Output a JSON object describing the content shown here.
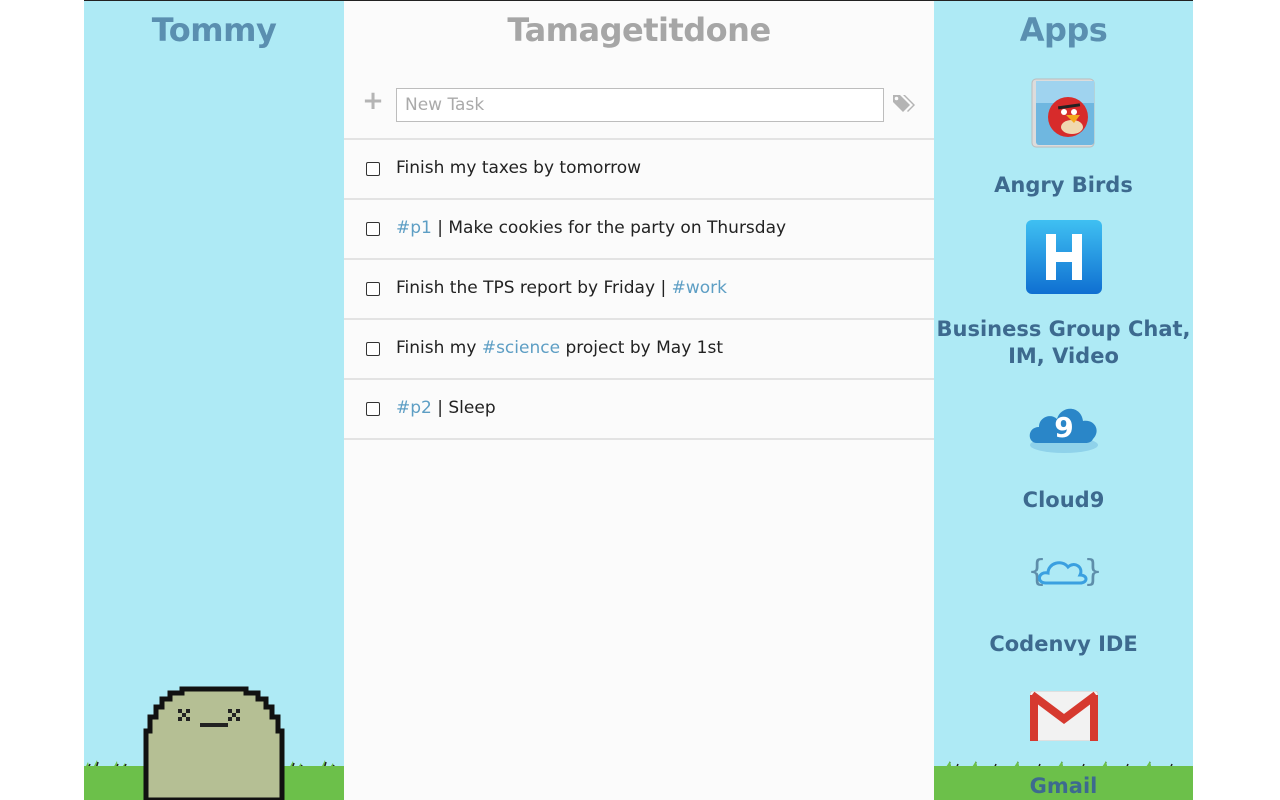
{
  "pet_panel": {
    "title": "Tommy"
  },
  "tasks_panel": {
    "title": "Tamagetitdone",
    "new_task_placeholder": "New Task",
    "tasks": [
      {
        "parts": [
          {
            "text": "Finish my taxes by tomorrow",
            "tag": false
          }
        ]
      },
      {
        "parts": [
          {
            "text": "#p1",
            "tag": true
          },
          {
            "text": " | Make cookies for the party on Thursday",
            "tag": false
          }
        ]
      },
      {
        "parts": [
          {
            "text": "Finish the TPS report by Friday | ",
            "tag": false
          },
          {
            "text": "#work",
            "tag": true
          }
        ]
      },
      {
        "parts": [
          {
            "text": "Finish my ",
            "tag": false
          },
          {
            "text": "#science",
            "tag": true
          },
          {
            "text": " project by May 1st",
            "tag": false
          }
        ]
      },
      {
        "parts": [
          {
            "text": "#p2",
            "tag": true
          },
          {
            "text": " | Sleep",
            "tag": false
          }
        ]
      }
    ]
  },
  "apps_panel": {
    "title": "Apps",
    "apps": [
      {
        "name": "Angry Birds",
        "icon": "angry-birds-icon"
      },
      {
        "name": "Business Group Chat, IM, Video",
        "icon": "hipchat-icon"
      },
      {
        "name": "Cloud9",
        "icon": "cloud9-icon"
      },
      {
        "name": "Codenvy IDE",
        "icon": "codenvy-icon"
      },
      {
        "name": "Gmail",
        "icon": "gmail-icon"
      }
    ]
  },
  "colors": {
    "panel_bg": "#aeeaf5",
    "title_blue": "#5a8fb0",
    "app_name": "#3d6a8f",
    "hashtag": "#5d9ec4",
    "grass": "#6cc04a",
    "pet": "#b5bf94"
  }
}
